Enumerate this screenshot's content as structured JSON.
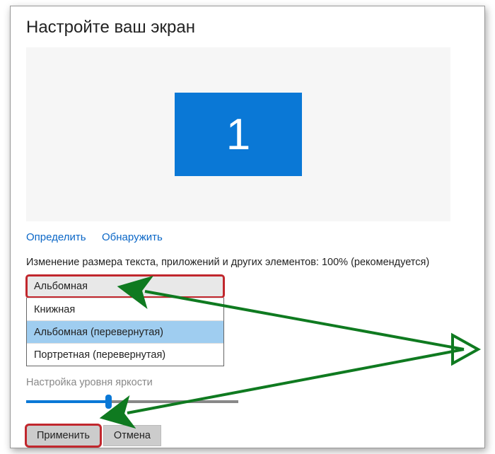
{
  "title": "Настройте ваш экран",
  "monitor_number": "1",
  "links": {
    "identify": "Определить",
    "detect": "Обнаружить"
  },
  "scale_label": "Изменение размера текста, приложений и других элементов: 100% (рекомендуется)",
  "orientation": {
    "selected": "Альбомная",
    "options": [
      "Книжная",
      "Альбомная (перевернутая)",
      "Портретная (перевернутая)"
    ],
    "hovered_index": 1
  },
  "brightness_label": "Настройка уровня яркости",
  "buttons": {
    "apply": "Применить",
    "cancel": "Отмена"
  }
}
